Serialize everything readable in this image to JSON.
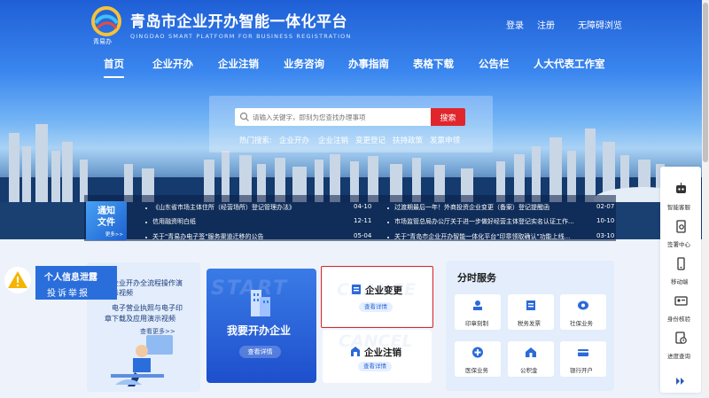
{
  "header": {
    "logo_caption": "青易办",
    "title": "青岛市企业开办智能一体化平台",
    "subtitle": "QINGDAO SMART PLATFORM FOR BUSINESS REGISTRATION",
    "login": "登录",
    "register": "注册",
    "accessible": "无障碍浏览"
  },
  "nav": [
    "首页",
    "企业开办",
    "企业注销",
    "业务咨询",
    "办事指南",
    "表格下载",
    "公告栏",
    "人大代表工作室"
  ],
  "search": {
    "placeholder": "请输入关键字，即刻为您查找办理事项",
    "button": "搜索",
    "hot_label": "热门搜索:",
    "hot": [
      "企业开办",
      "企业注销",
      "变更登记",
      "扶持政策",
      "发票申领"
    ]
  },
  "notice": {
    "badge_title_1": "通知",
    "badge_title_2": "文件",
    "badge_more": "更多>>",
    "left": [
      {
        "title": "《山东省市场主体住所（经营场所）登记管理办法》",
        "date": "04-10"
      },
      {
        "title": "信用融资明白纸",
        "date": "12-11"
      },
      {
        "title": "关于\"青易办电子签\"服务渠道迁移的公告",
        "date": "05-04"
      }
    ],
    "right": [
      {
        "title": "过渡期最后一年！外商投资企业变更（备案）登记提醒函",
        "date": "02-07"
      },
      {
        "title": "市场监管总局办公厅关于进一步做好经营主体登记实名认证工作...",
        "date": "10-10"
      },
      {
        "title": "关于\"青岛市企业开办智能一体化平台\"印章领取确认\"功能上线...",
        "date": "03-10"
      }
    ]
  },
  "privacy": {
    "line1": "个人信息泄露",
    "line2": "投诉举报"
  },
  "guide": {
    "line1": "企业开办全流程操作演",
    "line2": "示视频",
    "line3": "电子营业执照与电子印",
    "line4": "章下载及应用演示视频",
    "more": "查看更多>>"
  },
  "start": {
    "watermark": "START",
    "title": "我要开办企业",
    "button": "查看详情"
  },
  "change": {
    "watermark": "CHANGE",
    "title": "企业变更",
    "button": "查看详情"
  },
  "cancel": {
    "watermark": "CANCEL",
    "title": "企业注销",
    "button": "查看详情"
  },
  "time_services": {
    "title": "分时服务",
    "items": [
      "印章刻制",
      "税务发票",
      "社保业务",
      "医保业务",
      "公积金",
      "银行开户"
    ]
  },
  "sidebar": [
    "智能客服",
    "签署中心",
    "移动端",
    "身份核验",
    "进度查询"
  ],
  "colors": {
    "brand_blue": "#1e4fcd",
    "accent_red": "#e0262c",
    "panel_light": "#e3edfb"
  }
}
